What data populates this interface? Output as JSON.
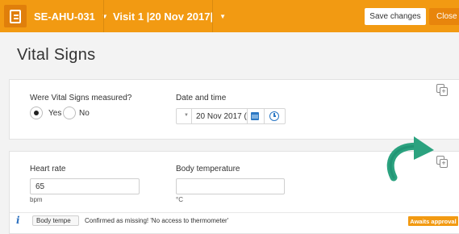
{
  "header": {
    "subject_id": "SE-AHU-031",
    "visit": "Visit 1 |20 Nov 2017|",
    "save_label": "Save changes",
    "close_label": "Close",
    "accent_color": "#f29a12"
  },
  "page": {
    "title": "Vital Signs"
  },
  "measured_section": {
    "question": "Were Vital Signs measured?",
    "options": [
      {
        "label": "Yes",
        "selected": true
      },
      {
        "label": "No",
        "selected": false
      }
    ],
    "date_label": "Date and time",
    "date_value": "20 Nov 2017 (",
    "icons": [
      "copy-icon",
      "calendar-icon",
      "clock-icon"
    ]
  },
  "vitals_section": {
    "heart_rate": {
      "label": "Heart rate",
      "value": "65",
      "unit": "bpm"
    },
    "body_temperature": {
      "label": "Body temperature",
      "value": "",
      "unit": "°C"
    },
    "icons": [
      "copy-icon",
      "curved-arrow-annotation"
    ]
  },
  "query": {
    "field": "Body tempe",
    "message": "Confirmed as missing! 'No access to thermometer'",
    "status": "Awaits approval",
    "status_color": "#f29a12"
  }
}
